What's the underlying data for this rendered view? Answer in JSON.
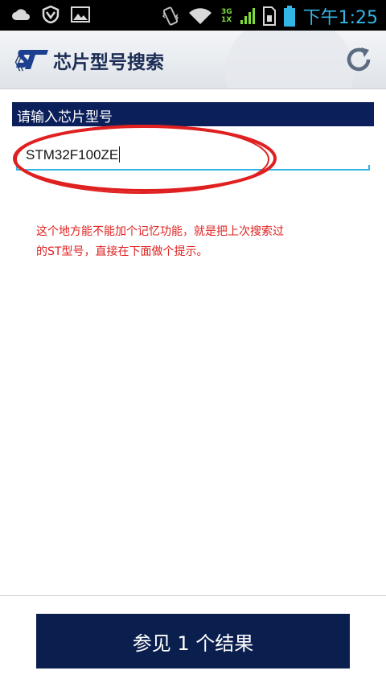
{
  "status_bar": {
    "time": "下午1:25",
    "network_top": "3G",
    "network_bottom": "1X"
  },
  "app_bar": {
    "back_chevron": "《",
    "logo": "ST",
    "title": "芯片型号搜索",
    "refresh_icon": "refresh-icon"
  },
  "search": {
    "label": "请输入芯片型号",
    "value": "STM32F100ZE"
  },
  "annotation": {
    "note": "这个地方能不能加个记忆功能，就是把上次搜索过的ST型号，直接在下面做个提示。",
    "color": "#e02020"
  },
  "footer": {
    "result_button_label": "参见 1 个结果"
  },
  "colors": {
    "header_navy": "#0b1f5a",
    "accent_blue": "#33b5e5",
    "button_navy": "#0b1f4f"
  }
}
